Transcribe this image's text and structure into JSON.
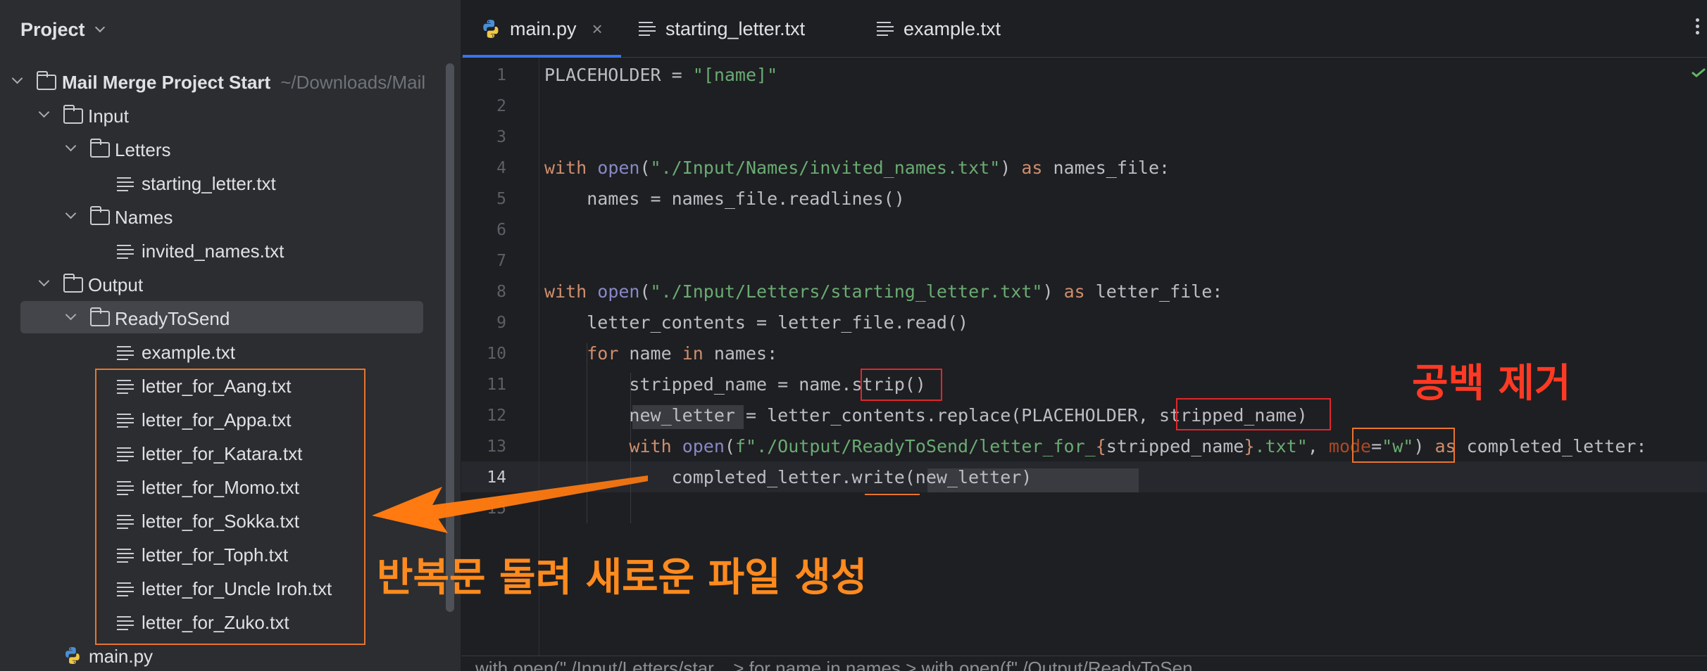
{
  "project": {
    "title": "Project",
    "tree": [
      {
        "label": "Mail Merge Project Start",
        "path": "~/Downloads/Mail"
      },
      {
        "label": "Input"
      },
      {
        "label": "Letters"
      },
      {
        "label": "starting_letter.txt"
      },
      {
        "label": "Names"
      },
      {
        "label": "invited_names.txt"
      },
      {
        "label": "Output"
      },
      {
        "label": "ReadyToSend"
      },
      {
        "label": "example.txt"
      },
      {
        "label": "letter_for_Aang.txt"
      },
      {
        "label": "letter_for_Appa.txt"
      },
      {
        "label": "letter_for_Katara.txt"
      },
      {
        "label": "letter_for_Momo.txt"
      },
      {
        "label": "letter_for_Sokka.txt"
      },
      {
        "label": "letter_for_Toph.txt"
      },
      {
        "label": "letter_for_Uncle Iroh.txt"
      },
      {
        "label": "letter_for_Zuko.txt"
      },
      {
        "label": "main.py"
      }
    ]
  },
  "tabs": [
    {
      "label": "main.py",
      "close": "×"
    },
    {
      "label": "starting_letter.txt"
    },
    {
      "label": "example.txt"
    }
  ],
  "editor": {
    "line_numbers": [
      "1",
      "2",
      "3",
      "4",
      "5",
      "6",
      "7",
      "8",
      "9",
      "10",
      "11",
      "12",
      "13",
      "14",
      "15"
    ],
    "code": {
      "l1a": "PLACEHOLDER = ",
      "l1b": "\"[name]\"",
      "l4a": "with",
      "l4b": " open",
      "l4c": "(",
      "l4d": "\"./Input/Names/invited_names.txt\"",
      "l4e": ") ",
      "l4f": "as",
      "l4g": " names_file:",
      "l5": "    names = names_file.readlines()",
      "l8a": "with",
      "l8b": " open",
      "l8c": "(",
      "l8d": "\"./Input/Letters/starting_letter.txt\"",
      "l8e": ") ",
      "l8f": "as",
      "l8g": " letter_file:",
      "l9": "    letter_contents = letter_file.read()",
      "l10a": "    ",
      "l10b": "for",
      "l10c": " name ",
      "l10d": "in",
      "l10e": " names:",
      "l11": "        stripped_name = name.strip()",
      "l12": "        new_letter = letter_contents.replace(PLACEHOLDER, stripped_name)",
      "l13a": "        ",
      "l13b": "with",
      "l13c": " open",
      "l13d": "(",
      "l13e": "f\"./Output/ReadyToSend/letter_for_",
      "l13f": "{",
      "l13g": "stripped_name",
      "l13h": "}",
      "l13i": ".txt\"",
      "l13j": ", ",
      "l13k": "mode",
      "l13l": "=",
      "l13m": "\"w\"",
      "l13n": ") ",
      "l13o": "as",
      "l13p": " completed_letter:",
      "l14": "            completed_letter.write(new_letter)"
    },
    "breadcrumb": "with open(\"./Input/Letters/star...  >  for name in names  >  with open(f\"./Output/ReadyToSen..."
  },
  "annotations": {
    "strip_note": "공백 제거",
    "loop_note": "반복문 돌려 새로운 파일 생성"
  },
  "colors": {
    "keyword": "#cf8e6d",
    "string": "#6aab73",
    "builtin": "#8888c6",
    "param": "#aa4926",
    "annotation_red": "#e0262d",
    "annotation_orange": "#e8742e",
    "tab_underline": "#3574f0"
  }
}
